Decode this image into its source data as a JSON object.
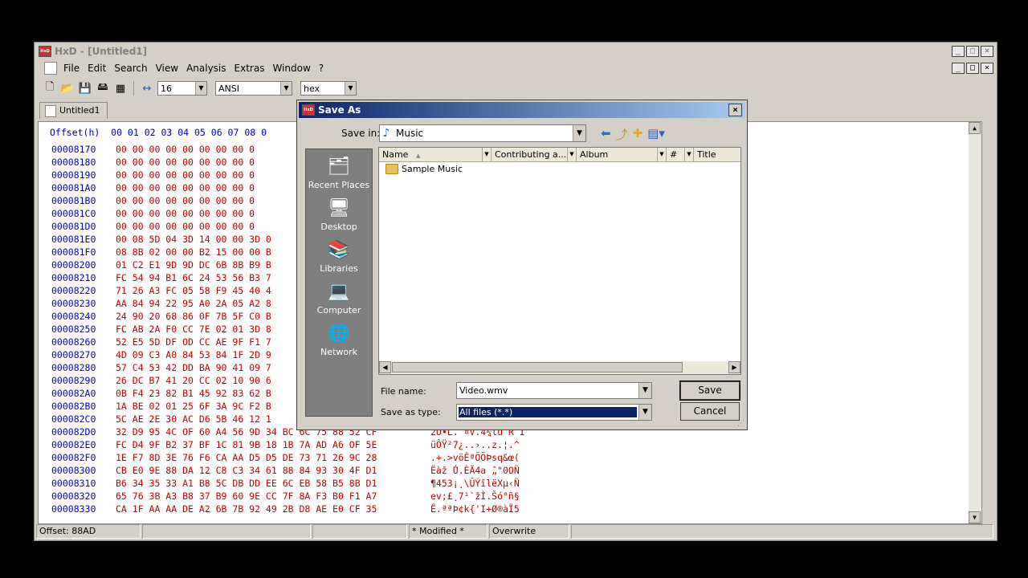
{
  "app": {
    "title": "HxD - [Untitled1]",
    "icon_label": "HxD"
  },
  "window_buttons": [
    "_",
    "□",
    "×"
  ],
  "menu": [
    "File",
    "Edit",
    "Search",
    "View",
    "Analysis",
    "Extras",
    "Window",
    "?"
  ],
  "toolbar": {
    "bytes_per_row": "16",
    "charset": "ANSI",
    "offset_base": "hex"
  },
  "tab": {
    "label": "Untitled1"
  },
  "hex": {
    "header": "Offset(h)  00 01 02 03 04 05 06 07 08 0",
    "rows": [
      {
        "off": "00008170",
        "bytes": "00 00 00 00 00 00 00 00 0",
        "text": ""
      },
      {
        "off": "00008180",
        "bytes": "00 00 00 00 00 00 00 00 0",
        "text": ""
      },
      {
        "off": "00008190",
        "bytes": "00 00 00 00 00 00 00 00 0",
        "text": ""
      },
      {
        "off": "000081A0",
        "bytes": "00 00 00 00 00 00 00 00 0",
        "text": ""
      },
      {
        "off": "000081B0",
        "bytes": "00 00 00 00 00 00 00 00 0",
        "text": ""
      },
      {
        "off": "000081C0",
        "bytes": "00 00 00 00 00 00 00 00 0",
        "text": ""
      },
      {
        "off": "000081D0",
        "bytes": "00 00 00 00 00 00 00 00 0",
        "text": ""
      },
      {
        "off": "000081E0",
        "bytes": "00 08 5D 04 3D 14 00 00 3D 0",
        "text": ""
      },
      {
        "off": "000081F0",
        "bytes": "08 8B 02 00 00 B2 15 00 00 B",
        "text": ""
      },
      {
        "off": "00008200",
        "bytes": "01 C2 E1 9D 9D DC 6B 8B B9 B",
        "text": ""
      },
      {
        "off": "00008210",
        "bytes": "FC 54 94 B1 6C 24 53 56 B3 7",
        "text": ""
      },
      {
        "off": "00008220",
        "bytes": "71 26 A3 FC 05 58 F9 45 40 4",
        "text": ""
      },
      {
        "off": "00008230",
        "bytes": "AA 84 94 22 95 A0 2A 05 A2 8",
        "text": ""
      },
      {
        "off": "00008240",
        "bytes": "24 90 20 68 86 0F 7B 5F C0 B",
        "text": ""
      },
      {
        "off": "00008250",
        "bytes": "FC AB 2A F0 CC 7E 02 01 3D 8",
        "text": ""
      },
      {
        "off": "00008260",
        "bytes": "52 E5 5D DF OD CC AE 9F F1 7",
        "text": ""
      },
      {
        "off": "00008270",
        "bytes": "4D 09 C3 A0 84 53 84 1F 2D 9",
        "text": ""
      },
      {
        "off": "00008280",
        "bytes": "57 C4 53 42 DD BA 90 41 09 7",
        "text": ""
      },
      {
        "off": "00008290",
        "bytes": "26 DC B7 41 20 CC 02 10 90 6",
        "text": ""
      },
      {
        "off": "000082A0",
        "bytes": "0B F4 23 82 B1 45 92 83 62 B",
        "text": ""
      },
      {
        "off": "000082B0",
        "bytes": "1A BE 02 01 25 6F 3A 9C F2 B",
        "text": ""
      },
      {
        "off": "000082C0",
        "bytes": "5C AE 2E 30 AC D6 5B 46 12 1",
        "text": ""
      },
      {
        "off": "000082D0",
        "bytes": "32 D9 95 4C OF 60 A4 56 9D 34 BC 6C 75 88 52 CF",
        "text": "2Ù•L.`¤V.4¼lu R Ï"
      },
      {
        "off": "000082E0",
        "bytes": "FC D4 9F B2 37 BF 1C 81 9B 18 1B 7A AD A6 OF 5E",
        "text": "üÔŸ²7¿..›..z.¦.^"
      },
      {
        "off": "000082F0",
        "bytes": "1E F7 8D 3E 76 F6 CA AA D5 D5 DE 73 71 26 9C 28",
        "text": ".÷.>vöÊªÕÕÞsq&œ("
      },
      {
        "off": "00008300",
        "bytes": "CB E0 9E 88 DA 12 C8 C3 34 61 88 84 93 30 4F D1",
        "text": "Ëàž ̂Ú.ÈÃ4a ̂„\"0OÑ"
      },
      {
        "off": "00008310",
        "bytes": "B6 34 35 33 A1 B8 5C DB DD EE 6C EB 58 B5 8B D1",
        "text": "¶453¡¸\\ÛÝîlëXµ‹Ñ"
      },
      {
        "off": "00008320",
        "bytes": "65 76 3B A3 B8 37 B9 60 9E CC 7F 8A F3 B0 F1 A7",
        "text": "ev;£¸7¹`žÌ.Šó°ñ§"
      },
      {
        "off": "00008330",
        "bytes": "CA 1F AA AA DE A2 6B 7B 92 49 2B D8 AE E0 CF 35",
        "text": "Ê.ªªÞ¢k{'I+Ø®àÏ5"
      }
    ]
  },
  "status": {
    "offset": "Offset: 88AD",
    "modified": "* Modified *",
    "mode": "Overwrite"
  },
  "dialog": {
    "title": "Save As",
    "save_in_label": "Save in:",
    "save_in_value": "Music",
    "places": [
      "Recent Places",
      "Desktop",
      "Libraries",
      "Computer",
      "Network"
    ],
    "columns": [
      "Name",
      "Contributing a...",
      "Album",
      "#",
      "Title"
    ],
    "items": [
      "Sample Music"
    ],
    "file_name_label": "File name:",
    "file_name_value": "Video.wmv",
    "save_type_label": "Save as type:",
    "save_type_value": "All files (*.*)",
    "save_button": "Save",
    "cancel_button": "Cancel"
  }
}
